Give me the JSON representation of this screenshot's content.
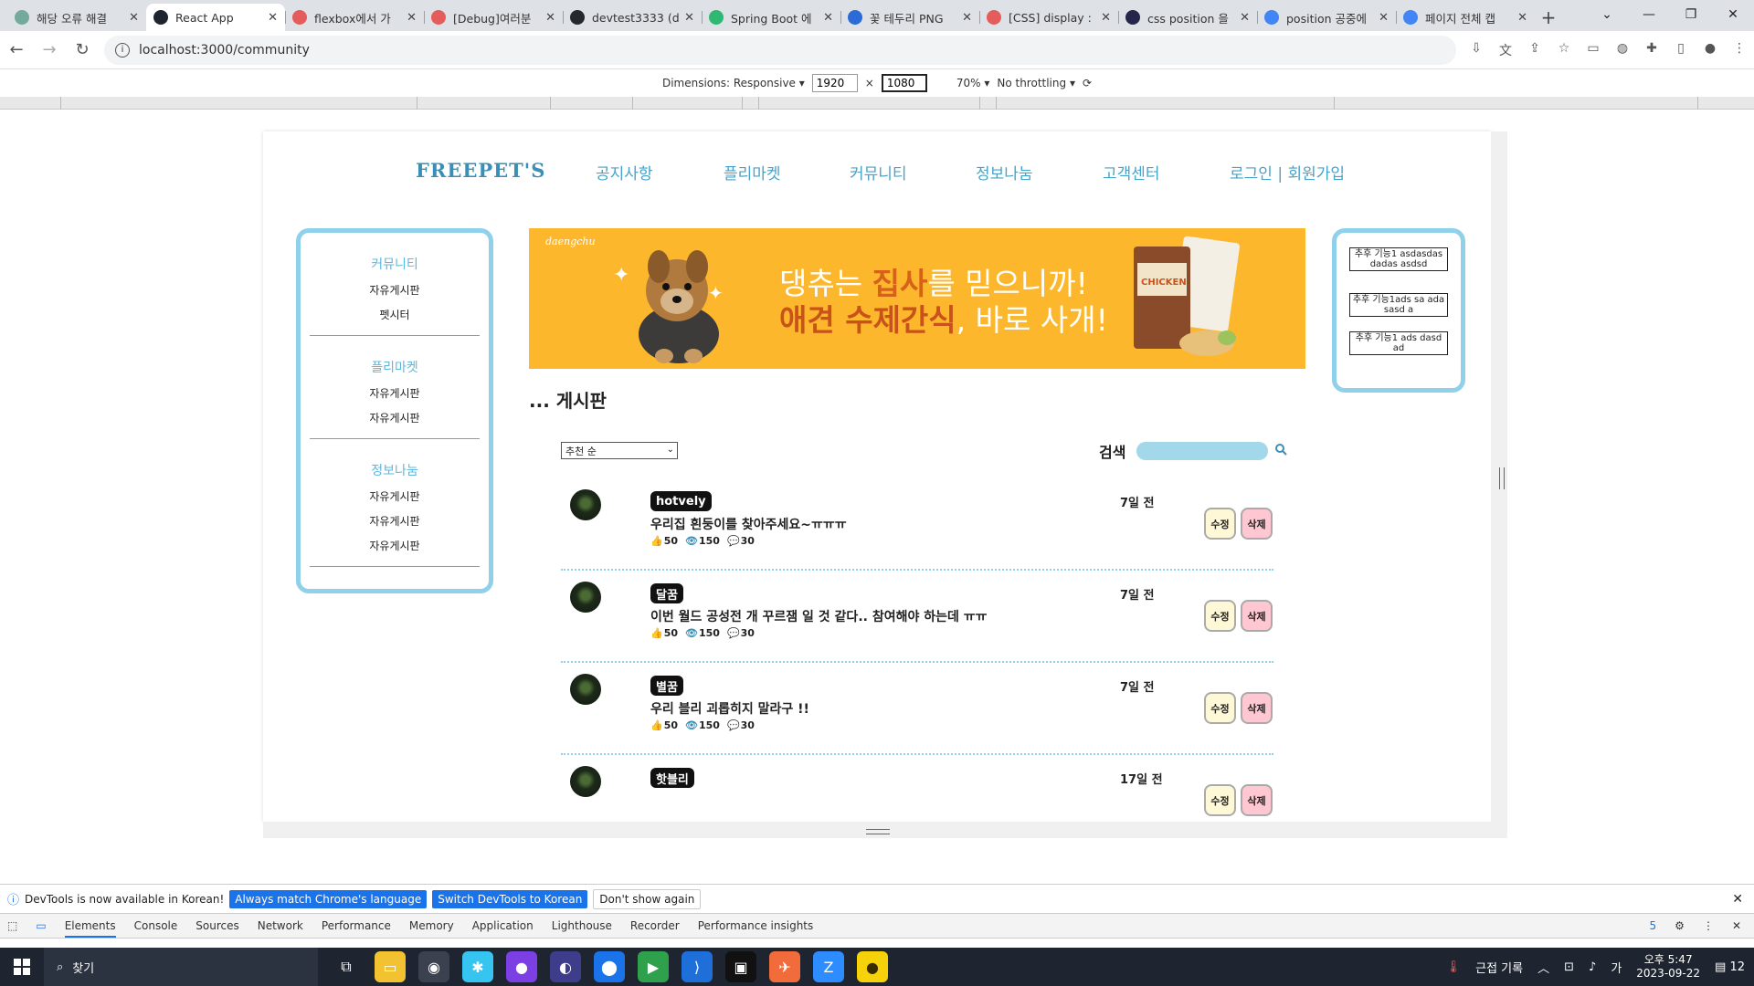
{
  "browser": {
    "tabs": [
      {
        "title": "해당 오류 해결",
        "color": "#74aa9c"
      },
      {
        "title": "React App",
        "color": "#1f2530",
        "active": true
      },
      {
        "title": "flexbox에서 가",
        "color": "#e55c5c"
      },
      {
        "title": "[Debug]여러분",
        "color": "#e55c5c"
      },
      {
        "title": "devtest3333 (d",
        "color": "#24292e"
      },
      {
        "title": "Spring Boot 에",
        "color": "#2eb872"
      },
      {
        "title": "꽃 테두리 PNG",
        "color": "#2a6bd6"
      },
      {
        "title": "[CSS] display :",
        "color": "#e55c5c"
      },
      {
        "title": "css position 을",
        "color": "#25264a"
      },
      {
        "title": "position 공중에",
        "color": "#4285f4"
      },
      {
        "title": "페이지 전체 캡",
        "color": "#4285f4"
      }
    ],
    "new_tab": "+",
    "url": "localhost:3000/community"
  },
  "devtools": {
    "dimensions_label": "Dimensions: Responsive",
    "width": "1920",
    "height": "1080",
    "times": "×",
    "zoom": "70%",
    "throttling": "No throttling",
    "notice_text": "DevTools is now available in Korean!",
    "notice_btn1": "Always match Chrome's language",
    "notice_btn2": "Switch DevTools to Korean",
    "notice_btn3": "Don't show again",
    "tabs": [
      "Elements",
      "Console",
      "Sources",
      "Network",
      "Performance",
      "Memory",
      "Application",
      "Lighthouse",
      "Recorder",
      "Performance insights"
    ],
    "badge": "5"
  },
  "site": {
    "logo": "FREEPET'S",
    "menu": [
      "공지사항",
      "플리마켓",
      "커뮤니티",
      "정보나눔",
      "고객센터",
      "로그인 | 회원가입"
    ],
    "left": {
      "sections": [
        {
          "title": "커뮤니티",
          "items": [
            "자유게시판",
            "펫시터"
          ]
        },
        {
          "title": "플리마켓",
          "items": [
            "자유게시판",
            "자유게시판"
          ]
        },
        {
          "title": "정보나눔",
          "items": [
            "자유게시판",
            "자유게시판",
            "자유게시판"
          ]
        }
      ]
    },
    "banner": {
      "script": "daengchu",
      "line1_a": "댕츄는 ",
      "line1_b": "집사",
      "line1_c": "를 믿으니까!",
      "line2_a": "애견 수제간식",
      "line2_b": ", 바로 사개!",
      "pack_label": "CHICKEN"
    },
    "right_boxes": [
      "추후 기능1 asdasdasdadas asdsd",
      "추후 기능1ads sa ada sasd a",
      "추후 기능1 ads dasd ad"
    ],
    "board_title": "... 게시판",
    "sort_value": "추천 순",
    "search_label": "검색",
    "posts": [
      {
        "nick": "hotvely",
        "time": "7일 전",
        "text": "우리집 흰둥이를 찾아주세요~ㅠㅠㅠ",
        "likes": "50",
        "views": "150",
        "comments": "30"
      },
      {
        "nick": "달꿈",
        "time": "7일 전",
        "text": "이번 월드 공성전 개 꾸르잼 일 것 같다.. 참여해야 하는데 ㅠㅠ",
        "likes": "50",
        "views": "150",
        "comments": "30"
      },
      {
        "nick": "별꿈",
        "time": "7일 전",
        "text": "우리 블리 괴롭히지 말라구 !!",
        "likes": "50",
        "views": "150",
        "comments": "30"
      },
      {
        "nick": "핫블리",
        "time": "17일 전",
        "text": "",
        "likes": "",
        "views": "",
        "comments": ""
      }
    ],
    "edit_label": "수정",
    "delete_label": "삭제"
  },
  "taskbar": {
    "search": "찾기",
    "weather": "근접 기록",
    "ime": "가",
    "time": "오후 5:47",
    "date": "2023-09-22",
    "notif": "12"
  }
}
